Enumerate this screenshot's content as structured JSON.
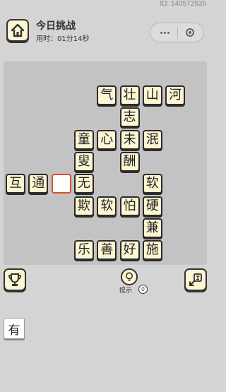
{
  "id_text": "ID: 140572535",
  "header": {
    "title": "今日挑战",
    "timer": "用时：01分14秒"
  },
  "board": {
    "tiles": [
      {
        "row": 0,
        "col": 4,
        "char": "气"
      },
      {
        "row": 0,
        "col": 5,
        "char": "壮"
      },
      {
        "row": 0,
        "col": 6,
        "char": "山"
      },
      {
        "row": 0,
        "col": 7,
        "char": "河"
      },
      {
        "row": 1,
        "col": 5,
        "char": "志"
      },
      {
        "row": 2,
        "col": 3,
        "char": "童"
      },
      {
        "row": 2,
        "col": 4,
        "char": "心"
      },
      {
        "row": 2,
        "col": 5,
        "char": "未"
      },
      {
        "row": 2,
        "col": 6,
        "char": "泯"
      },
      {
        "row": 3,
        "col": 3,
        "char": "叟"
      },
      {
        "row": 3,
        "col": 5,
        "char": "酬"
      },
      {
        "row": 4,
        "col": 0,
        "char": "互"
      },
      {
        "row": 4,
        "col": 1,
        "char": "通"
      },
      {
        "row": 4,
        "col": 2,
        "char": "",
        "blank": true
      },
      {
        "row": 4,
        "col": 3,
        "char": "无"
      },
      {
        "row": 4,
        "col": 6,
        "char": "软"
      },
      {
        "row": 5,
        "col": 3,
        "char": "欺"
      },
      {
        "row": 5,
        "col": 4,
        "char": "软"
      },
      {
        "row": 5,
        "col": 5,
        "char": "怕"
      },
      {
        "row": 5,
        "col": 6,
        "char": "硬"
      },
      {
        "row": 6,
        "col": 6,
        "char": "兼"
      },
      {
        "row": 7,
        "col": 3,
        "char": "乐"
      },
      {
        "row": 7,
        "col": 4,
        "char": "善"
      },
      {
        "row": 7,
        "col": 5,
        "char": "好"
      },
      {
        "row": 7,
        "col": 6,
        "char": "施"
      }
    ]
  },
  "hint": {
    "label": "提示",
    "count": "0"
  },
  "candidates": [
    "有"
  ]
}
